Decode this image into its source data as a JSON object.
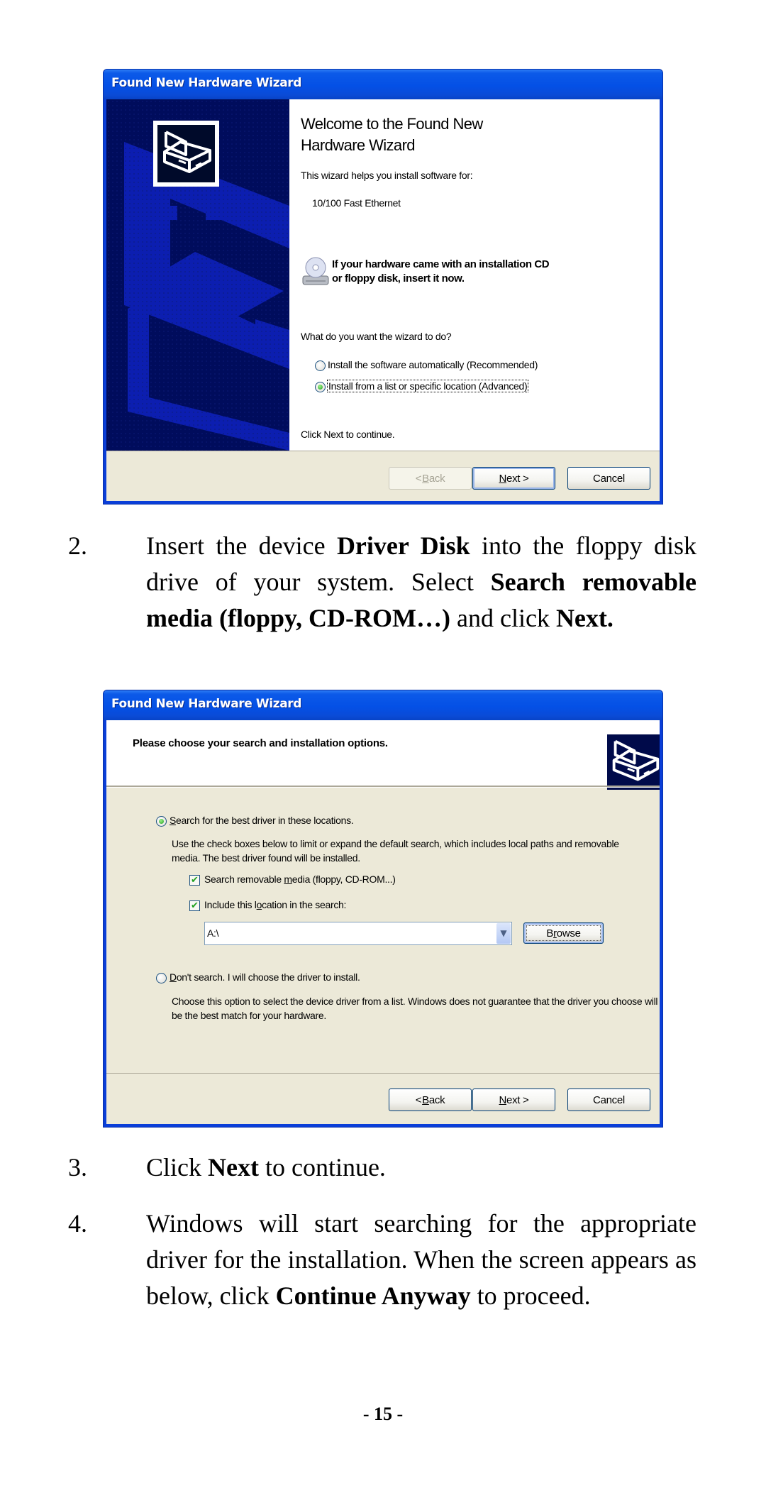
{
  "dialog1": {
    "title": "Found New Hardware Wizard",
    "heading_line1": "Welcome to the Found New",
    "heading_line2": "Hardware Wizard",
    "intro": "This wizard helps you install software for:",
    "device": "10/100 Fast Ethernet",
    "cd_notice_line1": "If your hardware came with an installation CD",
    "cd_notice_line2": "or floppy disk, insert it now.",
    "question": "What do you want the wizard to do?",
    "options": [
      {
        "label": "Install the software automatically (Recommended)",
        "selected": false
      },
      {
        "label": "Install from a list or specific location (Advanced)",
        "selected": true
      }
    ],
    "footer_hint": "Click Next to continue.",
    "buttons": {
      "back_prefix": "< ",
      "back_key": "B",
      "back_rest": "ack",
      "next_key": "N",
      "next_rest": "ext >",
      "cancel": "Cancel"
    },
    "back_enabled": false
  },
  "step2": {
    "number": "2.",
    "t1": "Insert the device ",
    "b1": "Driver Disk",
    "t2": " into the floppy disk drive of your system.  Select ",
    "b2": "Search removable media (floppy, CD-ROM…)",
    "t3": " and click ",
    "b3": "Next."
  },
  "dialog2": {
    "title": "Found New Hardware Wizard",
    "header": "Please choose your search and installation options.",
    "option_search": {
      "key": "S",
      "rest": "earch for the best driver in these locations.",
      "selected": true
    },
    "search_desc": "Use the check boxes below to limit or expand the default search, which includes local paths and removable media. The best driver found will be installed.",
    "check_removable": {
      "pre": "Search removable ",
      "key": "m",
      "post": "edia (floppy, CD-ROM...)",
      "checked": true
    },
    "check_location": {
      "pre": "Include this l",
      "key": "o",
      "post": "cation in the search:",
      "checked": true
    },
    "location_value": "A:\\",
    "browse": {
      "pre": "B",
      "key": "r",
      "post": "owse"
    },
    "option_dont": {
      "key": "D",
      "rest": "on't search. I will choose the driver to install.",
      "selected": false
    },
    "dont_desc": "Choose this option to select the device driver from a list.  Windows does not guarantee that the driver you choose will be the best match for your hardware.",
    "buttons": {
      "back_prefix": "< ",
      "back_key": "B",
      "back_rest": "ack",
      "next_key": "N",
      "next_rest": "ext >",
      "cancel": "Cancel"
    }
  },
  "step3": {
    "number": "3.",
    "t1": "Click ",
    "b1": "Next",
    "t2": " to continue."
  },
  "step4": {
    "number": "4.",
    "t1": "Windows will start searching for the appropriate driver for the installation. When the screen appears as below, click ",
    "b1": "Continue Anyway",
    "t2": " to proceed."
  },
  "page_number": "- 15 -",
  "colors": {
    "xp_blue": "#0450e6",
    "dialog_face": "#ece9d8",
    "watermark_navy": "#000c5c"
  }
}
